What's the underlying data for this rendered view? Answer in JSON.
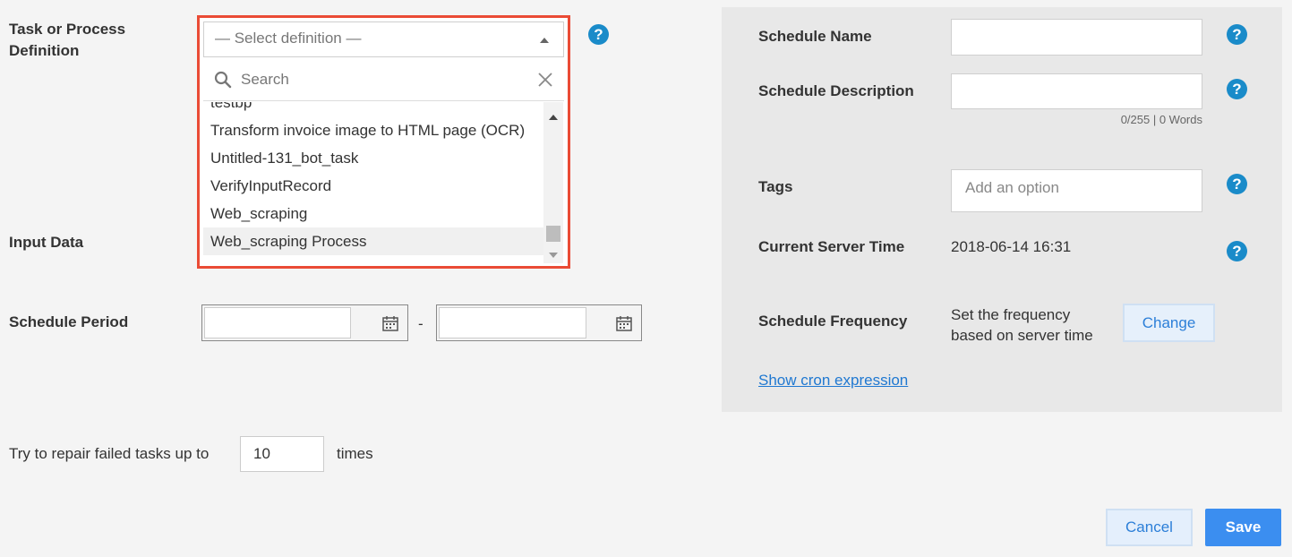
{
  "form": {
    "task_label": "Task or Process Definition",
    "input_data_label": "Input Data",
    "schedule_period_label": "Schedule Period",
    "date_separator": "-",
    "repair_label": "Try to repair failed tasks up to",
    "repair_value": "10",
    "repair_suffix": "times",
    "help_glyph": "?"
  },
  "definition_dropdown": {
    "placeholder": "— Select definition —",
    "search_placeholder": "Search",
    "options": [
      "testbp",
      "Transform invoice image to HTML page (OCR)",
      "Untitled-131_bot_task",
      "VerifyInputRecord",
      "Web_scraping",
      "Web_scraping Process"
    ],
    "highlighted_option": "Web_scraping Process",
    "highlight_color": "#ea4b35"
  },
  "schedule": {
    "name_label": "Schedule Name",
    "description_label": "Schedule Description",
    "word_count": "0/255 | 0 Words",
    "tags_label": "Tags",
    "tags_placeholder": "Add an option",
    "server_time_label": "Current Server Time",
    "server_time_value": "2018-06-14 16:31",
    "frequency_label": "Schedule Frequency",
    "frequency_text": "Set the frequency based on server time",
    "change_button": "Change",
    "cron_link": "Show cron expression"
  },
  "actions": {
    "cancel": "Cancel",
    "save": "Save"
  },
  "colors": {
    "primary": "#3b8ef0",
    "help_icon": "#1a8bc9",
    "link": "#1f78d1"
  }
}
